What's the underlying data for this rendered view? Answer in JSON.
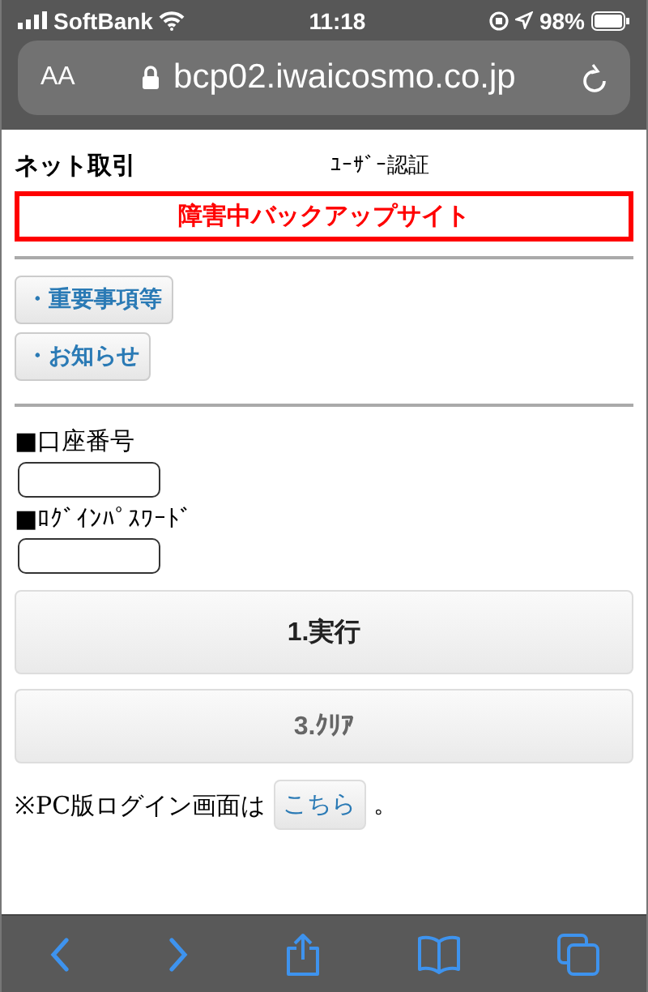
{
  "status_bar": {
    "carrier": "SoftBank",
    "time": "11:18",
    "battery": "98%"
  },
  "address_bar": {
    "text_size": "AA",
    "url": "bcp02.iwaicosmo.co.jp"
  },
  "header": {
    "title": "ネット取引",
    "subtitle": "ﾕｰｻﾞｰ認証"
  },
  "notice": "障害中バックアップサイト",
  "links": [
    "・重要事項等",
    "・お知らせ"
  ],
  "form": {
    "fields": [
      {
        "label": "■口座番号"
      },
      {
        "label": "■ﾛｸﾞｲﾝﾊﾟｽﾜｰﾄﾞ"
      }
    ],
    "buttons": [
      {
        "label": "1.実行",
        "kind": "primary"
      },
      {
        "label": "3.ｸﾘｱ",
        "kind": "secondary"
      }
    ]
  },
  "pc_login": {
    "text": "※PC版ログイン画面は",
    "link": "こちら",
    "suffix": "。"
  }
}
